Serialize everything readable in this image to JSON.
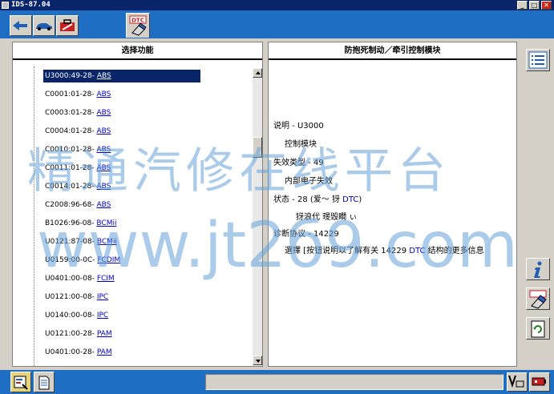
{
  "window": {
    "title": "IDS-87.04",
    "minimize_label": "_",
    "maximize_label": "□",
    "close_label": "✕"
  },
  "toolbar": {
    "buttons": [
      {
        "icon": "vehicle-connect-icon"
      },
      {
        "icon": "car-icon"
      },
      {
        "icon": "toolbox-icon"
      },
      {
        "icon": "dtc-eraser-icon",
        "label": "DTC"
      }
    ]
  },
  "left_panel": {
    "title": "选择功能",
    "items": [
      {
        "code": "U3000:49-28-",
        "module": "ABS",
        "selected": true
      },
      {
        "code": "C0001:01-28-",
        "module": "ABS"
      },
      {
        "code": "C0003:01-28-",
        "module": "ABS"
      },
      {
        "code": "C0004:01-28-",
        "module": "ABS"
      },
      {
        "code": "C0010:01-28-",
        "module": "ABS"
      },
      {
        "code": "C0011:01-28-",
        "module": "ABS"
      },
      {
        "code": "C0014:01-28-",
        "module": "ABS"
      },
      {
        "code": "C2008:96-68-",
        "module": "ABS"
      },
      {
        "code": "B1026:96-08-",
        "module": "BCMii"
      },
      {
        "code": "U0121:87-08-",
        "module": "BCMii"
      },
      {
        "code": "U0159:00-0C-",
        "module": "FCDIM"
      },
      {
        "code": "U0401:00-08-",
        "module": "FCIM"
      },
      {
        "code": "U0121:00-08-",
        "module": "IPC"
      },
      {
        "code": "U0140:00-08-",
        "module": "IPC"
      },
      {
        "code": "U0121:00-28-",
        "module": "PAM"
      },
      {
        "code": "U0401:00-28-",
        "module": "PAM"
      }
    ]
  },
  "right_panel": {
    "title": "防抱死制动／牵引控制模块",
    "lines": [
      {
        "text": "说明 - U3000"
      },
      {
        "text": "控制模块",
        "indent": true
      },
      {
        "text": "失效类型 - 49"
      },
      {
        "text": "内部电子失效",
        "indent": true
      },
      {
        "text": "状态 - 28 (爱～  犽 ",
        "link": "DTC",
        "suffix": ")"
      },
      {
        "text": "犽浪代    琝毁瞯  ぃ",
        "indent": true
      },
      {
        "text": "诊断协议 - 14229"
      },
      {
        "text": "選擇 [按钮说明以了解有关 14229 ",
        "link": "DTC",
        "suffix": " 结构的更多信息"
      }
    ]
  },
  "side_buttons": [
    {
      "icon": "list-icon"
    },
    {
      "icon": "info-icon"
    },
    {
      "icon": "eraser-icon"
    },
    {
      "icon": "refresh-document-icon"
    }
  ],
  "status_bar": {
    "tabs": [
      {
        "icon": "workspace-icon",
        "active": true
      },
      {
        "icon": "document-icon",
        "active": false
      }
    ],
    "status_text": "",
    "right_icons": [
      {
        "icon": "voltage-icon"
      },
      {
        "icon": "battery-icon"
      }
    ]
  },
  "watermark": {
    "line1": "精通汽修在线平台",
    "line2": "www.jt2б9.com"
  },
  "colors": {
    "toolbar_blue": "#1e6fc4",
    "titlebar": "#0a246a",
    "link": "#0000cc"
  }
}
